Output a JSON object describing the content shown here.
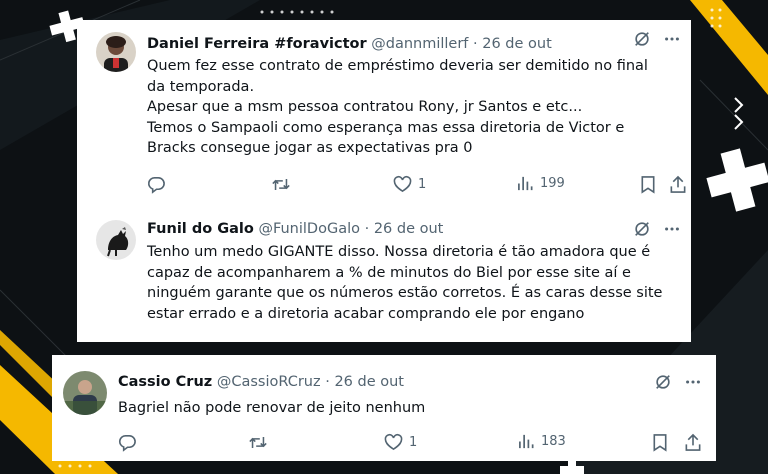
{
  "colors": {
    "background": "#0d1114",
    "accent_yellow": "#f5b800",
    "text_primary": "#0f1419",
    "text_secondary": "#536471"
  },
  "tweets": [
    {
      "name": "Daniel Ferreira #foravictor",
      "handle": "@dannmillerf",
      "separator": "·",
      "date": "26 de out",
      "text": "Quem fez esse contrato de empréstimo deveria ser demitido no final da temporada.\nApesar que a msm pessoa contratou Rony, jr Santos e etc...\nTemos o Sampaoli como esperança mas essa diretoria de Victor e Bracks consegue jogar as expectativas pra 0",
      "likes": "1",
      "views": "199"
    },
    {
      "name": "Funil do Galo",
      "handle": "@FunilDoGalo",
      "separator": "·",
      "date": "26 de out",
      "text": "Tenho um medo GIGANTE disso. Nossa diretoria é tão amadora que é capaz de acompanharem a % de minutos do Biel por esse site aí e ninguém garante que os números estão corretos. É as caras desse site estar errado e a diretoria acabar comprando ele por engano"
    },
    {
      "name": "Cassio Cruz",
      "handle": "@CassioRCruz",
      "separator": "·",
      "date": "26 de out",
      "text": "Bagriel não pode renovar de jeito nenhum",
      "likes": "1",
      "views": "183"
    }
  ],
  "icons": [
    "grok-icon",
    "more-icon",
    "reply-icon",
    "retweet-icon",
    "like-icon",
    "views-icon",
    "bookmark-icon",
    "share-icon"
  ]
}
